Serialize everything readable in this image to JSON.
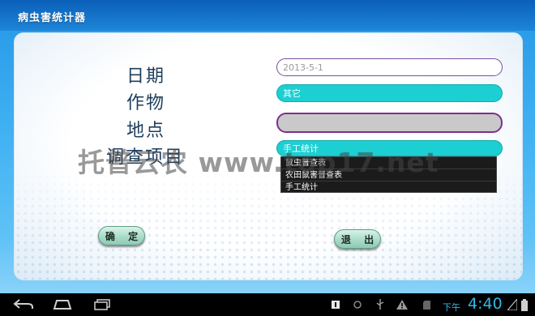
{
  "app": {
    "title": "病虫害统计器"
  },
  "form": {
    "labels": {
      "date": "日期",
      "crop": "作物",
      "place": "地点",
      "item": "调查项目"
    },
    "date_field": {
      "placeholder": "2013-5-1"
    },
    "crop_field": {
      "value": "其它"
    },
    "place_field": {
      "value": ""
    },
    "item_field": {
      "value": "手工统计"
    },
    "item_options": [
      "鼠虫普查表",
      "农田鼠害普查表",
      "手工统计"
    ]
  },
  "buttons": {
    "ok": "确 定",
    "exit": "退 出"
  },
  "watermark": "托普云农 www.top17.net",
  "system_bar": {
    "nav_icons": [
      "back-icon",
      "home-icon",
      "recent-apps-icon"
    ],
    "status_icons": [
      "notification-icon",
      "sync-icon",
      "usb-icon",
      "warning-icon",
      "sd-card-icon",
      "signal-icon",
      "battery-icon"
    ],
    "ampm": "下午",
    "time": "4:40",
    "accent_color": "#35b5e5"
  }
}
